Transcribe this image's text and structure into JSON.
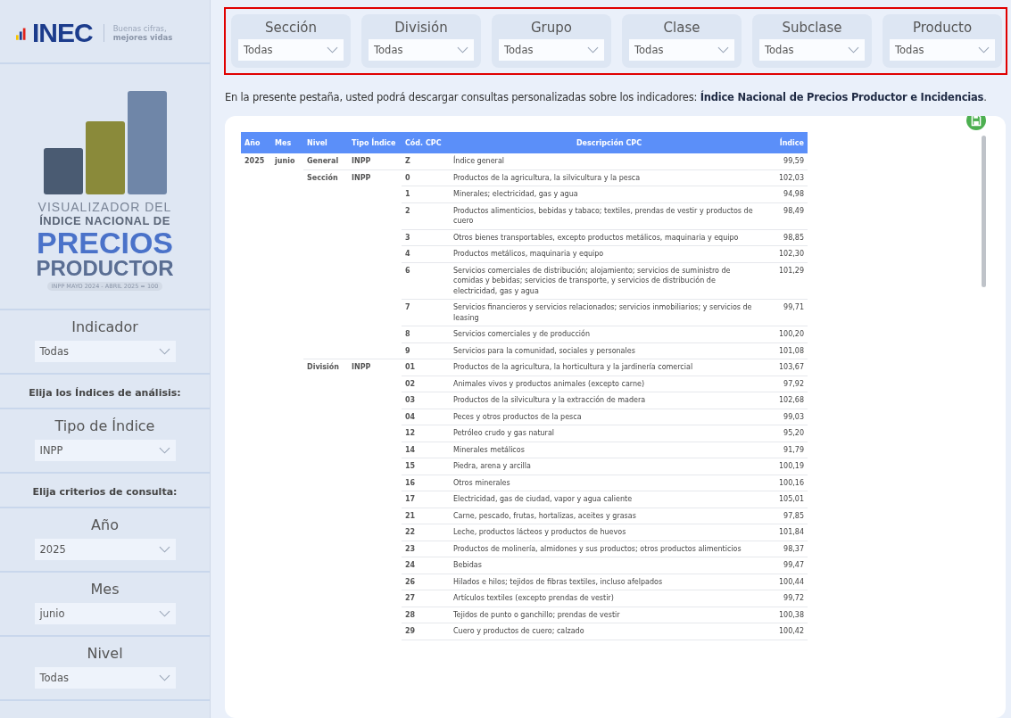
{
  "brand": {
    "logo": "INEC",
    "tagline_1": "Buenas cifras,",
    "tagline_2": "mejores vidas"
  },
  "hero": {
    "line_1": "VISUALIZADOR DEL",
    "line_2": "ÍNDICE NACIONAL DE",
    "line_3": "PRECIOS",
    "line_4": "PRODUCTOR",
    "base": "INPP MAYO 2024 - ABRIL 2025 = 100"
  },
  "sidebar": [
    {
      "kind": "filter",
      "label": "Indicador",
      "value": "Todas"
    },
    {
      "kind": "heading",
      "label": "Elija los Índices de análisis:"
    },
    {
      "kind": "filter",
      "label": "Tipo de Índice",
      "value": "INPP"
    },
    {
      "kind": "heading",
      "label": "Elija criterios de consulta:"
    },
    {
      "kind": "filter",
      "label": "Año",
      "value": "2025"
    },
    {
      "kind": "filter",
      "label": "Mes",
      "value": "junio"
    },
    {
      "kind": "filter",
      "label": "Nivel",
      "value": "Todas"
    }
  ],
  "filters": [
    {
      "label": "Sección",
      "value": "Todas"
    },
    {
      "label": "División",
      "value": "Todas"
    },
    {
      "label": "Grupo",
      "value": "Todas"
    },
    {
      "label": "Clase",
      "value": "Todas"
    },
    {
      "label": "Subclase",
      "value": "Todas"
    },
    {
      "label": "Producto",
      "value": "Todas"
    }
  ],
  "intro": "En la presente pestaña, usted podrá descargar consultas personalizadas sobre los indicadores: **Índice Nacional de Precios Productor e Incidencias**.",
  "table": {
    "columns": [
      "Año",
      "Mes",
      "Nivel",
      "Tipo Índice",
      "Cód. CPC",
      "Descripción CPC",
      "Índice"
    ],
    "groups": [
      {
        "year": "2025",
        "month": "junio",
        "level": "General",
        "type": "INPP",
        "rows": [
          {
            "code": "Z",
            "description": "Índice general",
            "value": "99,59"
          }
        ]
      },
      {
        "level": "Sección",
        "type": "INPP",
        "rows": [
          {
            "code": "0",
            "description": "Productos de la agricultura, la silvicultura y la pesca",
            "value": "102,03"
          },
          {
            "code": "1",
            "description": "Minerales; electricidad, gas y agua",
            "value": "94,98"
          },
          {
            "code": "2",
            "description": "Productos alimenticios, bebidas y tabaco; textiles, prendas de vestir y productos de cuero",
            "value": "98,49"
          },
          {
            "code": "3",
            "description": "Otros bienes transportables, excepto productos metálicos, maquinaria y equipo",
            "value": "98,85"
          },
          {
            "code": "4",
            "description": "Productos metálicos, maquinaria y equipo",
            "value": "102,30"
          },
          {
            "code": "6",
            "description": "Servicios comerciales de distribución; alojamiento; servicios de suministro de comidas y bebidas; servicios de transporte, y servicios de distribución de electricidad, gas y agua",
            "value": "101,29"
          },
          {
            "code": "7",
            "description": "Servicios financieros y servicios relacionados; servicios inmobiliarios; y servicios de leasing",
            "value": "99,71"
          },
          {
            "code": "8",
            "description": "Servicios comerciales y de producción",
            "value": "100,20"
          },
          {
            "code": "9",
            "description": "Servicios para la comunidad, sociales y personales",
            "value": "101,08"
          }
        ]
      },
      {
        "level": "División",
        "type": "INPP",
        "rows": [
          {
            "code": "01",
            "description": "Productos de la agricultura, la horticultura y la jardinería comercial",
            "value": "103,67"
          },
          {
            "code": "02",
            "description": "Animales vivos y productos animales (excepto carne)",
            "value": "97,92"
          },
          {
            "code": "03",
            "description": "Productos de la silvicultura y la extracción de madera",
            "value": "102,68"
          },
          {
            "code": "04",
            "description": "Peces y otros productos de la pesca",
            "value": "99,03"
          },
          {
            "code": "12",
            "description": "Petróleo crudo y gas natural",
            "value": "95,20"
          },
          {
            "code": "14",
            "description": "Minerales metálicos",
            "value": "91,79"
          },
          {
            "code": "15",
            "description": "Piedra, arena y arcilla",
            "value": "100,19"
          },
          {
            "code": "16",
            "description": "Otros minerales",
            "value": "100,16"
          },
          {
            "code": "17",
            "description": "Electricidad, gas de ciudad, vapor y agua caliente",
            "value": "105,01"
          },
          {
            "code": "21",
            "description": "Carne, pescado, frutas, hortalizas, aceites y grasas",
            "value": "97,85"
          },
          {
            "code": "22",
            "description": "Leche, productos lácteos y productos de huevos",
            "value": "101,84"
          },
          {
            "code": "23",
            "description": "Productos de molinería, almidones y sus productos; otros productos alimenticios",
            "value": "98,37"
          },
          {
            "code": "24",
            "description": "Bebidas",
            "value": "99,47"
          },
          {
            "code": "26",
            "description": "Hilados e hilos; tejidos de fibras textiles, incluso afelpados",
            "value": "100,44"
          },
          {
            "code": "27",
            "description": "Artículos textiles (excepto prendas de vestir)",
            "value": "99,72"
          },
          {
            "code": "28",
            "description": "Tejidos de punto o ganchillo; prendas de vestir",
            "value": "100,38"
          },
          {
            "code": "29",
            "description": "Cuero y productos de cuero; calzado",
            "value": "100,42"
          }
        ]
      }
    ]
  }
}
